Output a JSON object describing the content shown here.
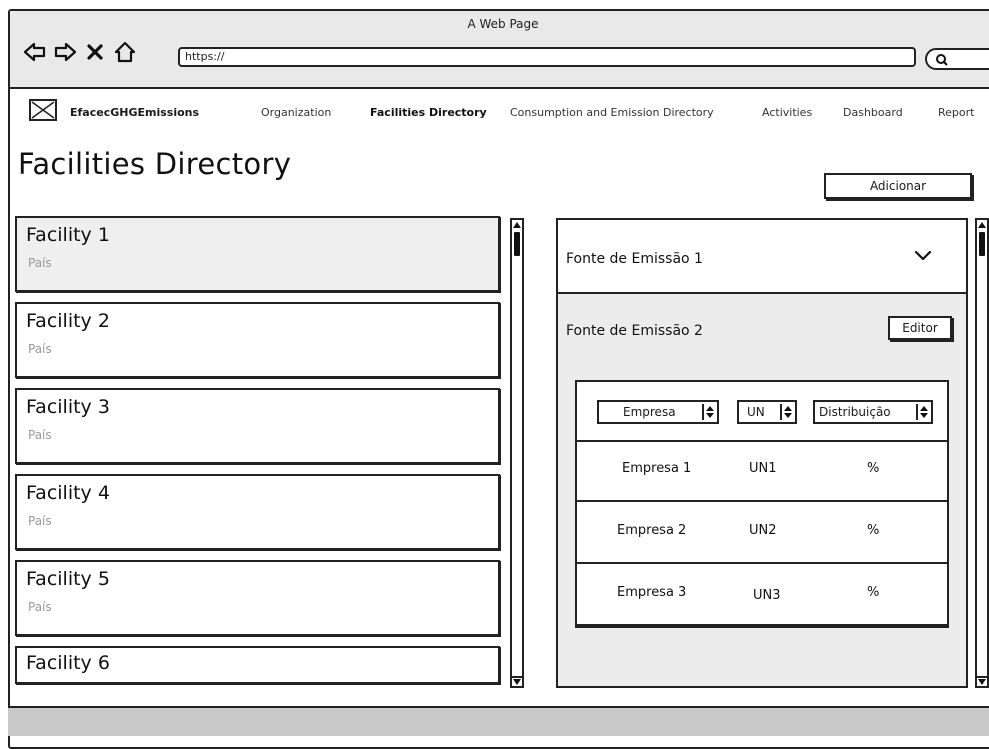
{
  "window": {
    "title": "A Web Page"
  },
  "browser": {
    "url": "https://"
  },
  "header": {
    "logo_text": "EfacecGHGEmissions",
    "nav": [
      {
        "label": "Organization",
        "active": false
      },
      {
        "label": "Facilities Directory",
        "active": true
      },
      {
        "label": "Consumption and Emission Directory",
        "active": false
      },
      {
        "label": "Activities",
        "active": false
      },
      {
        "label": "Dashboard",
        "active": false
      },
      {
        "label": "Report",
        "active": false
      }
    ]
  },
  "page": {
    "title": "Facilities Directory",
    "add_label": "Adicionar"
  },
  "facilities": [
    {
      "name": "Facility 1",
      "sub": "País",
      "selected": true
    },
    {
      "name": "Facility 2",
      "sub": "País",
      "selected": false
    },
    {
      "name": "Facility 3",
      "sub": "País",
      "selected": false
    },
    {
      "name": "Facility 4",
      "sub": "País",
      "selected": false
    },
    {
      "name": "Facility 5",
      "sub": "País",
      "selected": false
    },
    {
      "name": "Facility 6",
      "sub": "",
      "selected": false
    }
  ],
  "details": {
    "source1": "Fonte de Emissão 1",
    "source2": "Fonte de Emissão 2",
    "edit_label": "Editor",
    "filters": {
      "empresa": "Empresa",
      "un": "UN",
      "distribuicao": "Distribuição"
    },
    "rows": [
      {
        "empresa": "Empresa 1",
        "un": "UN1",
        "dist": "%"
      },
      {
        "empresa": "Empresa 2",
        "un": "UN2",
        "dist": "%"
      },
      {
        "empresa": "Empresa 3",
        "un": "UN3",
        "dist": "%"
      }
    ]
  }
}
